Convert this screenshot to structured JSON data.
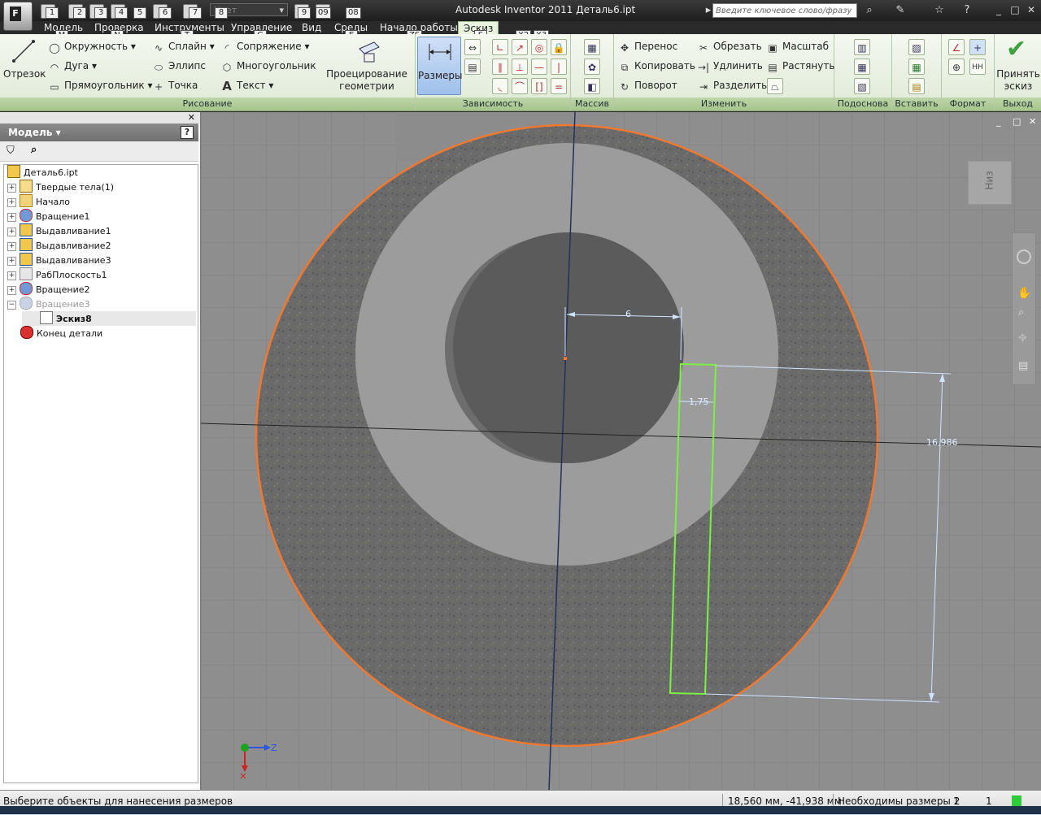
{
  "titlebar": {
    "app_letter": "F",
    "title": "Autodesk Inventor 2011    Деталь6.ipt",
    "color_placeholder": "Цвет",
    "search_placeholder": "Введите ключевое слово/фразу",
    "keytips": [
      "1",
      "2",
      "3",
      "4",
      "5",
      "6",
      "7",
      "8",
      "9",
      "09",
      "08"
    ]
  },
  "tabs": {
    "items": [
      "Модель",
      "Проверка",
      "Инструменты",
      "Управление",
      "Вид",
      "Среды",
      "Начало работы",
      "Эскиз"
    ],
    "keytips": [
      "M",
      "N",
      "T",
      "G",
      "V",
      "E",
      "ZS",
      "S",
      "X2",
      "X3"
    ]
  },
  "ribbon": {
    "draw": {
      "line": "Отрезок",
      "circle": "Окружность",
      "arc": "Дуга",
      "rectangle": "Прямоугольник",
      "spline": "Сплайн",
      "ellipse": "Эллипс",
      "point": "Точка",
      "fillet": "Сопряжение",
      "polygon": "Многоугольник",
      "text": "Текст",
      "project_geometry": "Проецирование геометрии",
      "title": "Рисование"
    },
    "constrain": {
      "dimensions": "Размеры",
      "title": "Зависимость"
    },
    "pattern": {
      "title": "Массив"
    },
    "modify": {
      "move": "Перенос",
      "copy": "Копировать",
      "rotate": "Поворот",
      "trim": "Обрезать",
      "extend": "Удлинить",
      "split": "Разделить",
      "scale": "Масштаб",
      "stretch": "Растянуть",
      "title": "Изменить"
    },
    "layout": {
      "title": "Подоснова"
    },
    "insert": {
      "title": "Вставить"
    },
    "format": {
      "title": "Формат"
    },
    "exit": {
      "finish_sketch": "Принять эскиз",
      "title": "Выход"
    }
  },
  "browser": {
    "title": "Модель",
    "tree": [
      {
        "label": "Деталь6.ipt",
        "icon": "part-icon"
      },
      {
        "label": "Твердые тела(1)",
        "icon": "solid-bodies-icon"
      },
      {
        "label": "Начало",
        "icon": "folder-icon"
      },
      {
        "label": "Вращение1",
        "icon": "revolve-icon"
      },
      {
        "label": "Выдавливание1",
        "icon": "extrude-icon"
      },
      {
        "label": "Выдавливание2",
        "icon": "extrude-icon"
      },
      {
        "label": "Выдавливание3",
        "icon": "extrude-icon"
      },
      {
        "label": "РабПлоскость1",
        "icon": "work-plane-icon"
      },
      {
        "label": "Вращение2",
        "icon": "revolve-icon"
      },
      {
        "label": "Вращение3",
        "icon": "revolve-icon"
      },
      {
        "label": "Эскиз8",
        "icon": "sketch-icon"
      },
      {
        "label": "Конец детали",
        "icon": "end-of-part-icon"
      }
    ]
  },
  "viewport": {
    "viewcube_face": "Низ",
    "dims": {
      "d1": "6",
      "d2": "1,75",
      "d3": "16,986"
    },
    "axis_z": "Z"
  },
  "status": {
    "prompt": "Выберите объекты для нанесения размеров",
    "coords": "18,560 мм, -41,938 мм",
    "dims_needed": "Необходимы размеры 2",
    "count1": "1",
    "count2": "1"
  },
  "colors": {
    "ribbon_green": "#a6c48c",
    "sketch_profile": "#7cf043",
    "circle_edge": "#f07830"
  }
}
